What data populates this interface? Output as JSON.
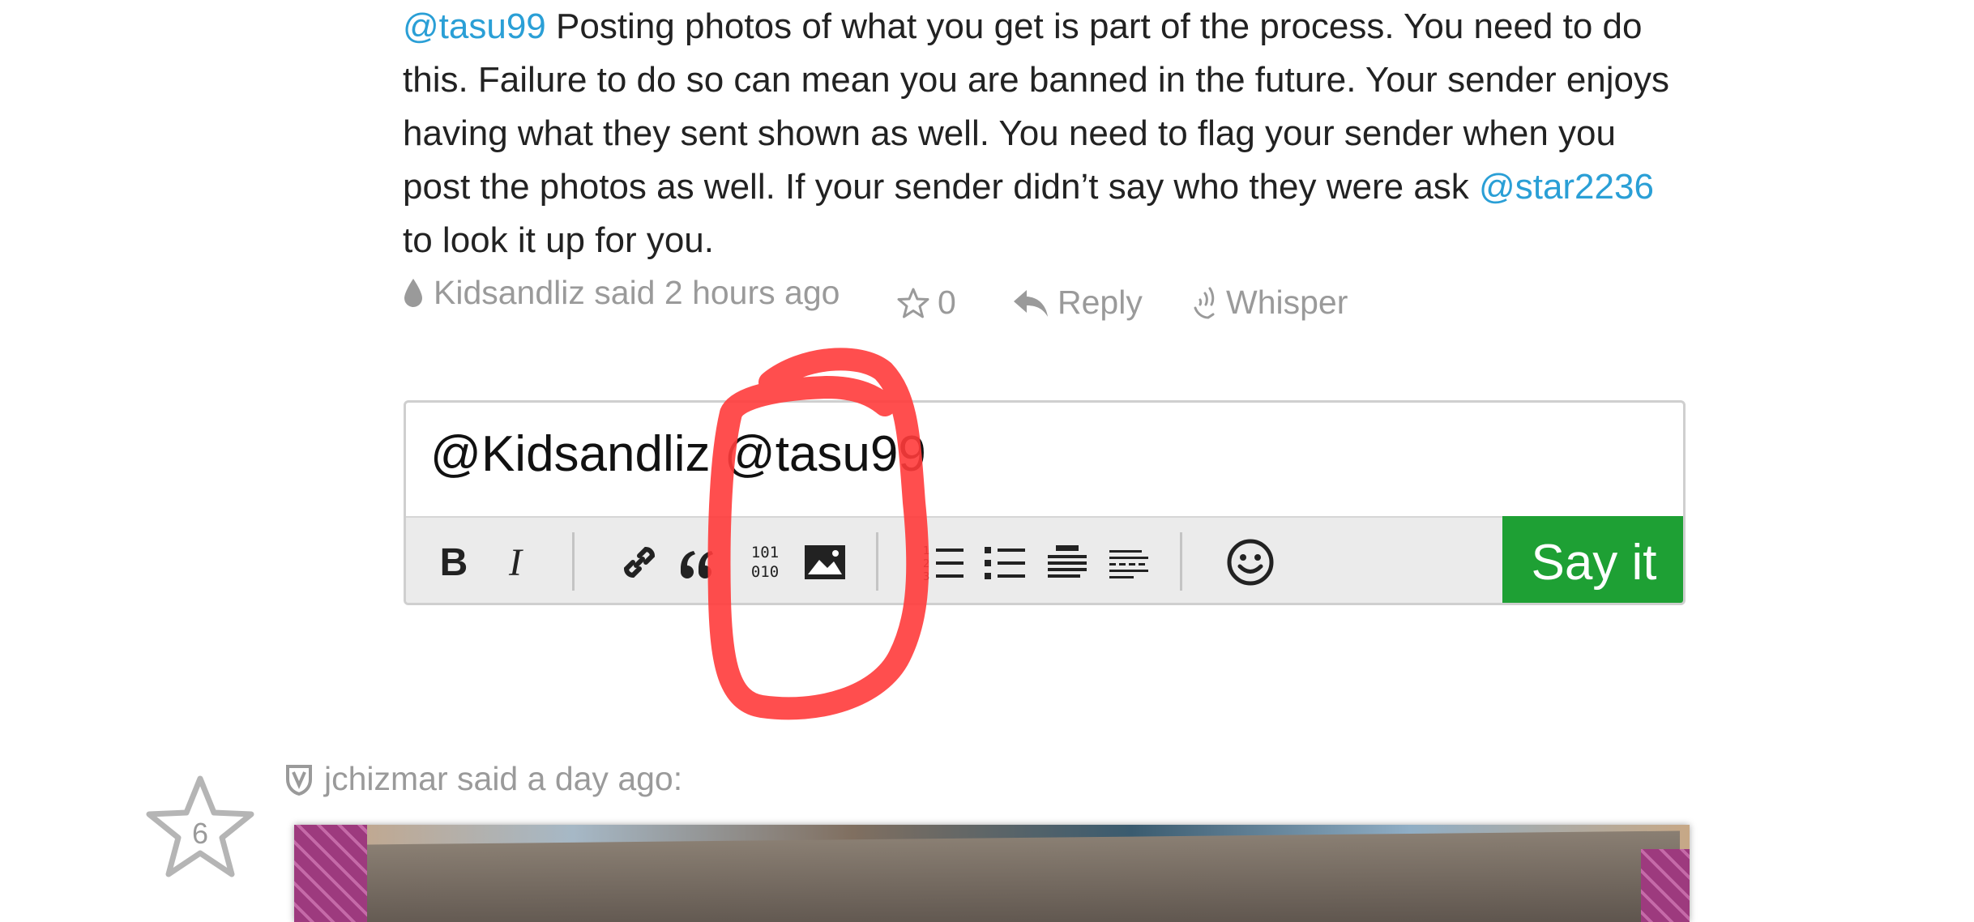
{
  "post": {
    "mention_user": "@tasu99",
    "text_part1": " Posting photos of what you get is part of the process. You need to do this. Failure to do so can mean you are banned in the future. Your sender enjoys having what they sent shown as well. You need to flag your sender when you post the photos as well. If your sender didn’t say who they were ask ",
    "mention_star": "@star2236",
    "text_part2": " to look it up for you.",
    "author_line": "Kidsandliz said 2 hours ago",
    "star_count": "0",
    "reply_label": "Reply",
    "whisper_label": "Whisper"
  },
  "editor": {
    "input_value": "@Kidsandliz @tasu99",
    "toolbar_icons": [
      "bold-icon",
      "italic-icon",
      "link-icon",
      "quote-icon",
      "code-icon",
      "image-icon",
      "numbered-list-icon",
      "bullet-list-icon",
      "heading-icon",
      "horizontal-rule-icon",
      "emoji-icon"
    ],
    "bold_glyph": "B",
    "italic_glyph": "I",
    "submit_label": "Say it",
    "submit_color": "#1ea034"
  },
  "annotation": {
    "color": "#ff3b3b"
  },
  "comment": {
    "author_line": "jchizmar said a day ago:",
    "vote_count": "6"
  },
  "colors": {
    "mention": "#2a9fd6",
    "meta": "#9a9a9a"
  }
}
